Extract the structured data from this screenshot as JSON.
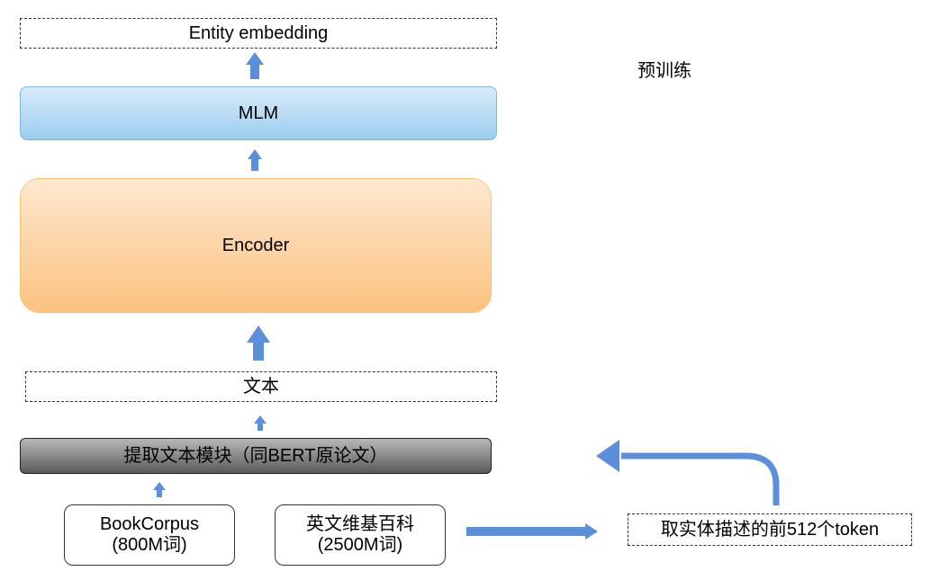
{
  "diagram": {
    "entity_embedding": "Entity embedding",
    "pretrain": "预训练",
    "mlm": "MLM",
    "encoder": "Encoder",
    "text": "文本",
    "extract_module": "提取文本模块（同BERT原论文）",
    "bookcorpus": {
      "name": "BookCorpus",
      "size": "(800M词)"
    },
    "wikipedia": {
      "name": "英文维基百科",
      "size": "(2500M词)"
    },
    "truncate": "取实体描述的前512个token"
  },
  "colors": {
    "arrow": "#5b8fd9",
    "mlm_fill": "#9bcdf0",
    "encoder_fill": "#fbc27f",
    "extract_fill": "#5a5a5a"
  }
}
